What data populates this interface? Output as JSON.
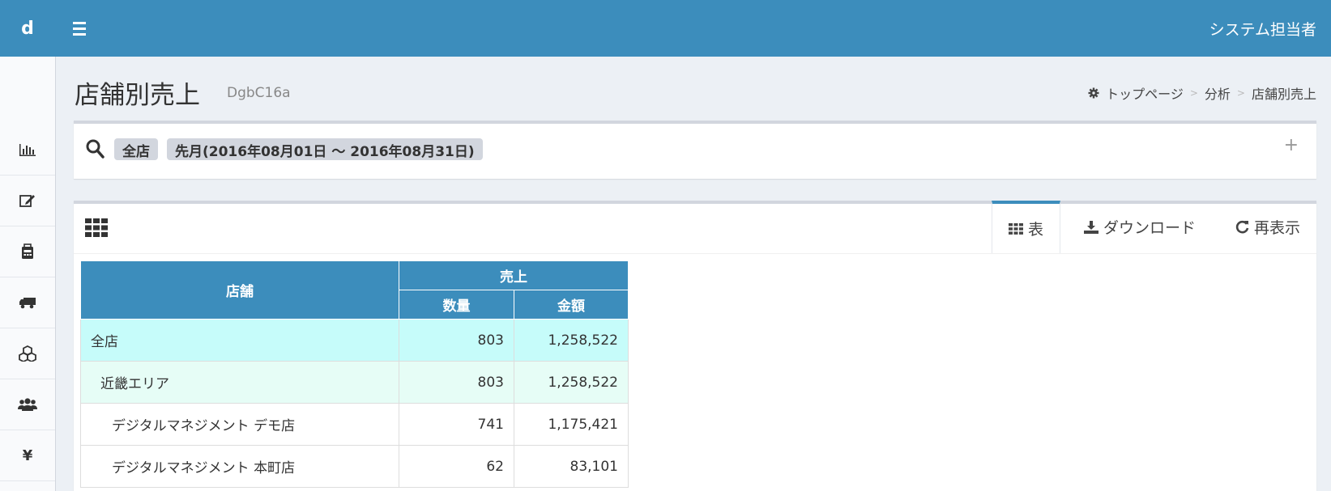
{
  "header": {
    "logo": "d",
    "user": "システム担当者"
  },
  "sidebar": {
    "items": [
      {
        "icon": "bar-chart-icon"
      },
      {
        "icon": "edit-icon"
      },
      {
        "icon": "calculator-icon"
      },
      {
        "icon": "truck-icon"
      },
      {
        "icon": "cubes-icon"
      },
      {
        "icon": "users-icon"
      },
      {
        "icon": "yen-icon",
        "glyph": "¥"
      }
    ]
  },
  "page": {
    "title": "店舗別売上",
    "subtitle": "DgbC16a"
  },
  "breadcrumb": {
    "home": "トップページ",
    "level1": "分析",
    "current": "店舗別売上"
  },
  "search": {
    "tags": [
      "全店",
      "先月(2016年08月01日 ～ 2016年08月31日)"
    ],
    "expand": "+"
  },
  "tabs": {
    "table": "表",
    "download": "ダウンロード",
    "refresh": "再表示"
  },
  "table": {
    "headers": {
      "store": "店舗",
      "sales": "売上",
      "quantity": "数量",
      "amount": "金額"
    },
    "rows": [
      {
        "name": "全店",
        "quantity": "803",
        "amount": "1,258,522"
      },
      {
        "name": "近畿エリア",
        "quantity": "803",
        "amount": "1,258,522"
      },
      {
        "name": "デジタルマネジメント デモ店",
        "quantity": "741",
        "amount": "1,175,421"
      },
      {
        "name": "デジタルマネジメント 本町店",
        "quantity": "62",
        "amount": "83,101"
      }
    ]
  },
  "colors": {
    "brand": "#3c8dbc",
    "total_row": "#c6fcfa",
    "area_row": "#e6fdf6"
  }
}
